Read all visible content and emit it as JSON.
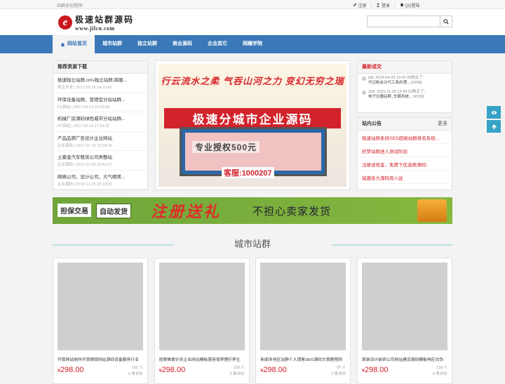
{
  "topbar": {
    "slogan": "站群优化程序!",
    "register": "注册",
    "login": "登录",
    "qq_login": "QQ登陆"
  },
  "logo": {
    "mark": "e",
    "cn": "极速站群源码",
    "en": "www.jilcn.com"
  },
  "search": {
    "placeholder": ""
  },
  "nav": {
    "items": [
      "网站首页",
      "城市站群",
      "独立站群",
      "商业源码",
      "企业其它",
      "网赚学院"
    ]
  },
  "left_panel": {
    "title": "推荐资源下载",
    "items": [
      {
        "title": "极速独立站群,cms独立站群,跨服...",
        "meta": "首主开发 | 2017-05-19 14:10:42"
      },
      {
        "title": "环保设备站群，营销型分站站群...",
        "meta": "PC网站 | 2017-04-14 16:26:08"
      },
      {
        "title": "机械厂房源码绿色城市分站站群...",
        "meta": "PC网站 | 2017-02-23 17:16:22"
      },
      {
        "title": "产品品牌广告设计企业网站",
        "meta": "企业源码 | 2017-01-10 15:24:10"
      },
      {
        "title": "土豪金汽车租赁公司类整站",
        "meta": "企业源码 | 2017-01-09 15:44:17"
      },
      {
        "title": "网络公司，设计公司，大气精美...",
        "meta": "企业源码 | 2016-12-25 20:19:02"
      }
    ]
  },
  "banner": {
    "slogan": "行云流水之柔 气吞山河之力 变幻无穷之瑞",
    "title": "极速分城市企业源码",
    "auth": "专业授权500元",
    "qq": "客服:1000207"
  },
  "right_panel": {
    "title": "最新成交",
    "deals": [
      {
        "user": "tdll.",
        "time": "2024-04-29 13:42:35购买了：",
        "item": "代记帐会计代工商办理...",
        "price": "[¥298]"
      },
      {
        "user": "158.",
        "time": "2021-11-29 15:49:23购买了：",
        "item": "电子仪器站群_车载系统...",
        "price": "[¥298]"
      }
    ],
    "notice_title": "站内公告",
    "notice_more": "更多",
    "notices": [
      "极速站群系统SEO超级站群排名系统...",
      "织梦站群进入测试阶段",
      "注册送现金，免费下优选质源码!",
      "诚邀各大源码商入驻"
    ]
  },
  "adbar": {
    "tag1": "担保交易",
    "tag2": "自动发货",
    "headline": "注册送礼",
    "sub": "不担心卖家发货"
  },
  "section": {
    "title": "城市站群"
  },
  "cards": [
    {
      "name": "开锁网站制作开锁换锁网站源码设备服务行业",
      "price": "298.00",
      "currency": "¥",
      "views": "152 人",
      "reviews": "0 条评价"
    },
    {
      "name": "按摩推拿针灸企业网站模板美容保养理疗养生",
      "price": "298.00",
      "currency": "¥",
      "views": "118 人",
      "reviews": "0 条评价"
    },
    {
      "name": "新闻多地区站群个人博客SEO源码文章教程网",
      "price": "298.00",
      "currency": "¥",
      "views": "97 人",
      "reviews": "0 条评价"
    },
    {
      "name": "家装设计装饰公司网站建设源码模板响应式伪",
      "price": "298.00",
      "currency": "¥",
      "views": "118 人",
      "reviews": "0 条评价"
    }
  ],
  "colors": {
    "nav": "#3a78b7",
    "price": "#d2222b",
    "side_tools": "#36a3c7"
  }
}
